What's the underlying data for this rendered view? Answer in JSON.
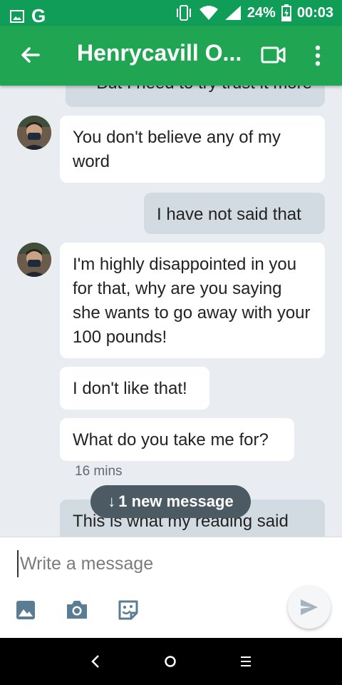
{
  "status_bar": {
    "battery_percent": "24%",
    "time": "00:03",
    "google_label": "G"
  },
  "header": {
    "title": "Henrycavill O..."
  },
  "messages": [
    {
      "direction": "out",
      "text": "But I need to try trust it more"
    },
    {
      "direction": "in",
      "text": "You don't believe any of my word"
    },
    {
      "direction": "out",
      "text": "I have not said that"
    },
    {
      "direction": "in",
      "text": "I'm highly disappointed in you for that, why are you saying she wants to go away with your 100 pounds!"
    },
    {
      "direction": "in",
      "text": "I don't like that!"
    },
    {
      "direction": "in",
      "text": "What do you take me for?"
    },
    {
      "direction": "out",
      "text": "This is what my reading said"
    }
  ],
  "timestamp": "16 mins",
  "new_message_pill": {
    "arrow": "↓",
    "label": "1 new message"
  },
  "composer": {
    "placeholder": "Write a message"
  },
  "colors": {
    "status_bar": "#0f9d58",
    "app_bar": "#20a653",
    "chat_background": "#e9edf1",
    "incoming_bubble": "#ffffff",
    "outgoing_bubble": "#d3dbe2",
    "pill": "#4b5a63",
    "icon_blue": "#5a7d93"
  },
  "icons": [
    "image-icon",
    "google-icon",
    "vibrate-icon",
    "wifi-icon",
    "signal-icon",
    "battery-icon",
    "back-arrow-icon",
    "video-call-icon",
    "more-vert-icon",
    "gallery-icon",
    "camera-icon",
    "sticker-icon",
    "send-icon",
    "nav-back-icon",
    "nav-home-icon",
    "nav-recents-icon"
  ]
}
